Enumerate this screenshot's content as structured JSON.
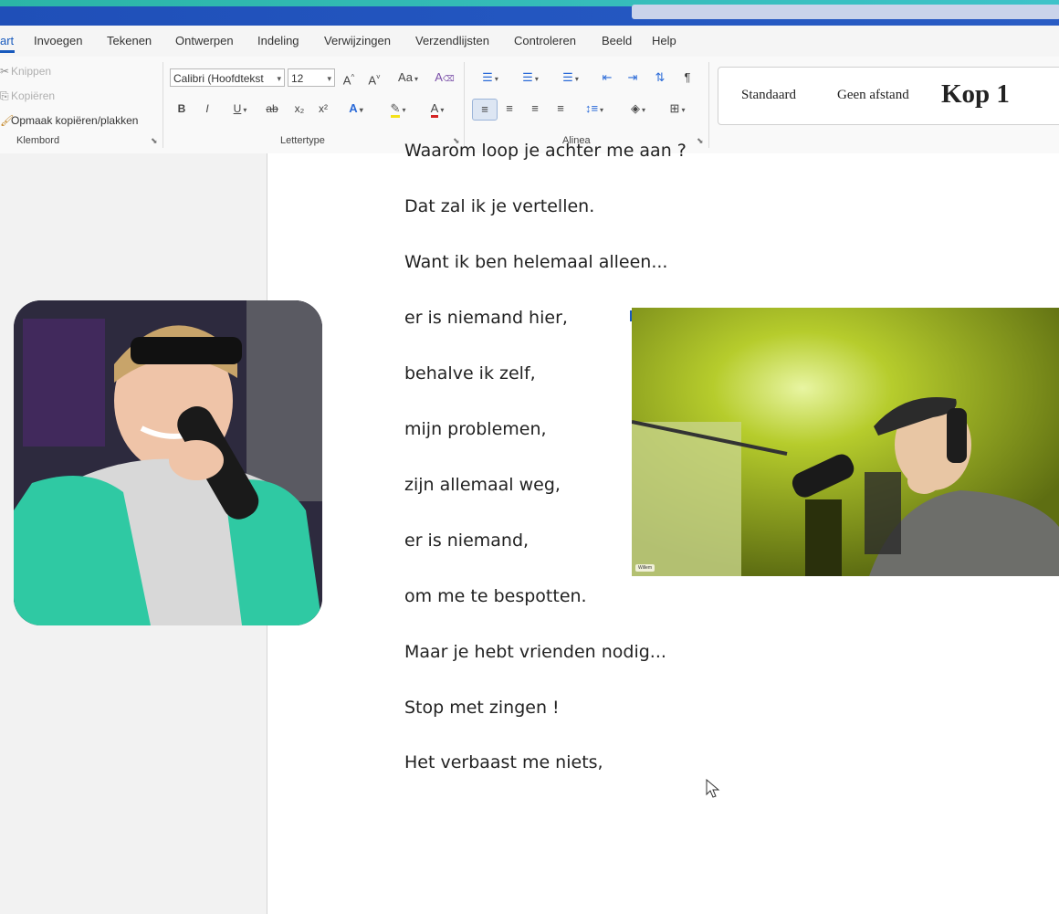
{
  "tabs": [
    "art",
    "Invoegen",
    "Tekenen",
    "Ontwerpen",
    "Indeling",
    "Verwijzingen",
    "Verzendlijsten",
    "Controleren",
    "Beeld",
    "Help"
  ],
  "clipboard": {
    "cut": "Knippen",
    "copy": "Kopiëren",
    "format_painter": "Opmaak kopiëren/plakken",
    "label": "Klembord"
  },
  "font": {
    "name": "Calibri (Hoofdtekst",
    "size": "12",
    "grow": "A^",
    "shrink": "A˅",
    "case": "Aa",
    "bold": "B",
    "italic": "I",
    "underline": "U",
    "strike": "ab",
    "subscript": "x₂",
    "superscript": "x²",
    "effects": "A",
    "color": "A",
    "label": "Lettertype"
  },
  "paragraph": {
    "label": "Alinea",
    "pilcrow": "¶"
  },
  "styles": {
    "normal": "Standaard",
    "no_spacing": "Geen afstand",
    "heading1": "Kop 1"
  },
  "document_lines": [
    "Waarom loop je achter me aan ?",
    "Dat zal ik je vertellen.",
    "Want ik ben helemaal alleen...",
    "er is niemand hier,",
    "behalve ik zelf,",
    "mijn problemen,",
    "zijn allemaal weg,",
    "er is niemand,",
    "om me te bespotten.",
    "Maar je hebt vrienden nodig...",
    "Stop met zingen !",
    "Het verbaast me niets,"
  ],
  "webcam2_name_tag": "Willem"
}
